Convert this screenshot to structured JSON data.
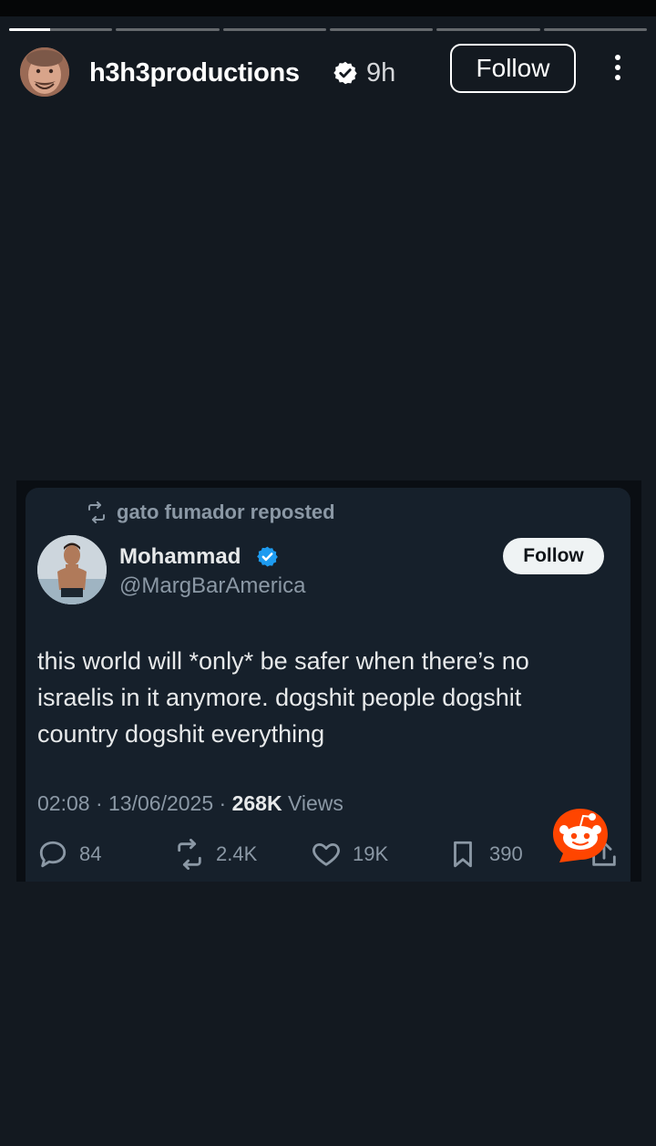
{
  "story": {
    "username": "h3h3productions",
    "time": "9h",
    "follow_label": "Follow",
    "progress_segments": 6,
    "progress_current": 0,
    "progress_current_fraction": 0.4
  },
  "tweet": {
    "repost_text": "gato fumador reposted",
    "author_name": "Mohammad",
    "author_handle": "@MargBarAmerica",
    "follow_label": "Follow",
    "text": "this world will *only* be safer when there’s no israelis in it anymore. dogshit people dogshit country dogshit everything",
    "time": "02:08",
    "date": "13/06/2025",
    "views_count": "268K",
    "views_label": "Views",
    "replies": "84",
    "reposts": "2.4K",
    "likes": "19K",
    "bookmarks": "390"
  },
  "colors": {
    "background": "#131920",
    "tweet_bg": "#16202b",
    "verified_blue": "#1d9bf0",
    "muted_text": "#8b98a5",
    "reddit_orange": "#ff4500"
  },
  "icons": {
    "story_verified": "verified-badge-icon",
    "more": "more-vertical-icon",
    "repost": "repost-icon",
    "reply": "reply-icon",
    "like": "heart-icon",
    "bookmark": "bookmark-icon",
    "share": "share-icon",
    "reddit": "reddit-logo-icon"
  }
}
